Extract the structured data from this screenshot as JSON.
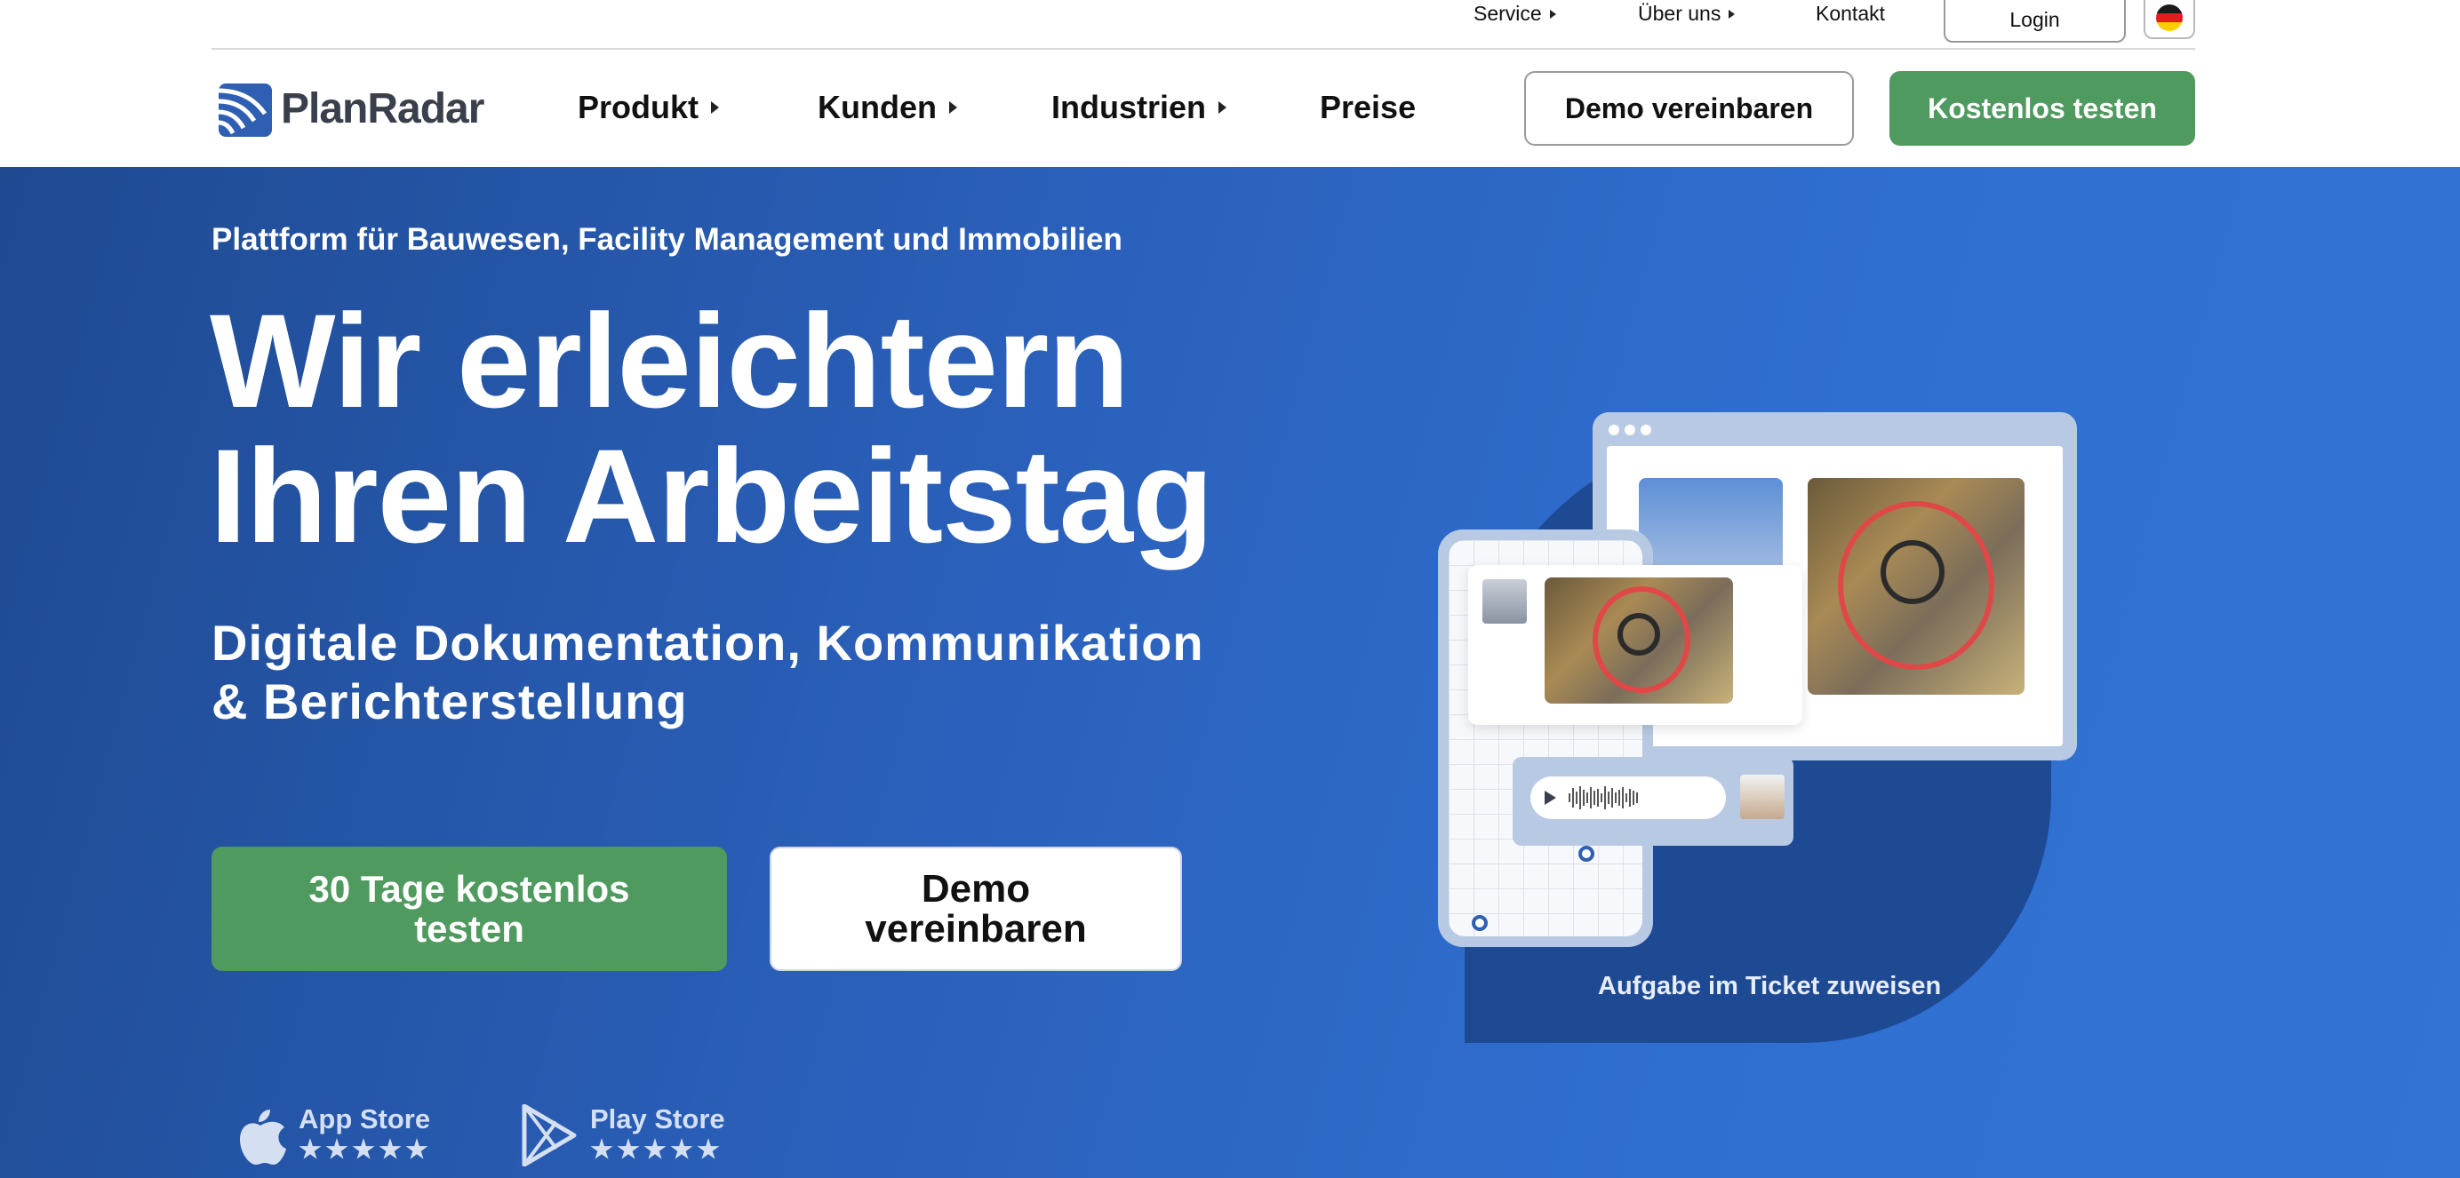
{
  "utility": {
    "service": "Service",
    "about": "Über uns",
    "contact": "Kontakt",
    "login": "Login",
    "language_flag": "flag-de-icon"
  },
  "nav": {
    "logo_text": "PlanRadar",
    "items": [
      {
        "label": "Produkt",
        "has_caret": true
      },
      {
        "label": "Kunden",
        "has_caret": true
      },
      {
        "label": "Industrien",
        "has_caret": true
      },
      {
        "label": "Preise",
        "has_caret": false
      }
    ],
    "demo_label": "Demo vereinbaren",
    "trial_label": "Kostenlos testen"
  },
  "hero": {
    "eyebrow": "Plattform für Bauwesen, Facility Management und Immobilien",
    "headline_line1": "Wir erleichtern",
    "headline_line2": "Ihren Arbeitstag",
    "subline_line1": "Digitale Dokumentation, Kommunikation",
    "subline_line2": "& Berichterstellung",
    "cta_trial": "30 Tage kostenlos testen",
    "cta_demo": "Demo vereinbaren",
    "illustration_caption": "Aufgabe im Ticket zuweisen"
  },
  "stores": [
    {
      "name": "App Store",
      "icon": "apple-icon",
      "rating": 5
    },
    {
      "name": "Play Store",
      "icon": "play-store-icon",
      "rating": 5
    }
  ],
  "colors": {
    "accent_green": "#4f9a5f",
    "hero_blue": "#2a5fb9",
    "logo_blue": "#2f5fb3"
  }
}
